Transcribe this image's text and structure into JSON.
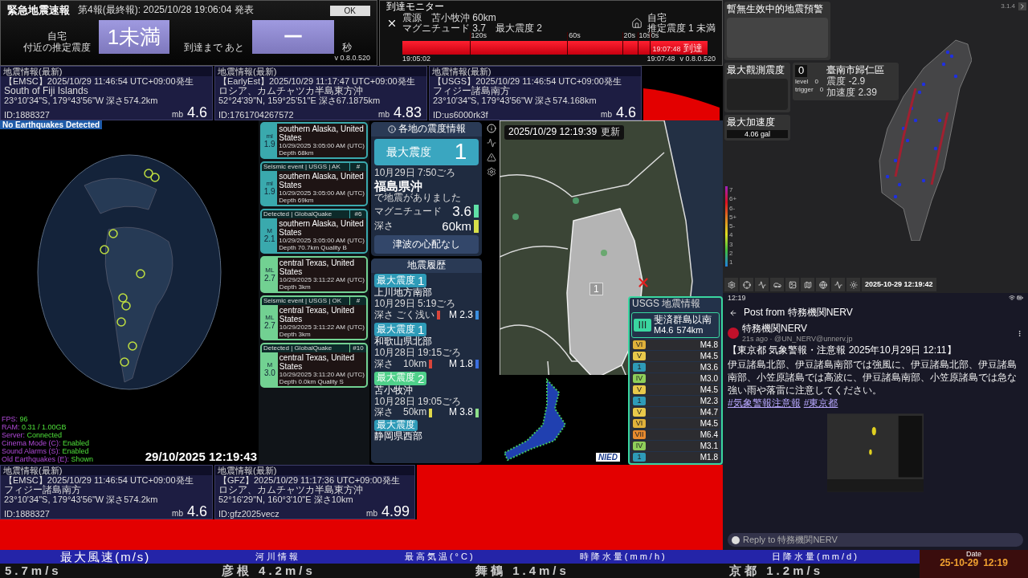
{
  "eew": {
    "title": "緊急地震速報",
    "report": "第4報(最終報): 2025/10/28 19:06:04 発表",
    "ok_button": "OK",
    "location_1": "自宅",
    "location_2": "付近の推定震度",
    "intensity": "1未満",
    "until_label": "到達まで あと",
    "seconds": "ー",
    "seconds_unit": "秒",
    "version": "v 0.8.0.520"
  },
  "arrival_monitor": {
    "title": "到達モニター",
    "epicenter": "震源　苫小牧沖 60km",
    "magnitude": "マグニチュード 3.7　最大震度 2",
    "home": "自宅",
    "home_intensity": "推定震度 1 未満",
    "ticks": [
      "120s",
      "60s",
      "20s",
      "10s",
      "0s"
    ],
    "arrival_time": "19:07:48",
    "arrival_label": "到達",
    "start_time": "19:05:02",
    "end_time": "19:07:48",
    "version": "v 0.8.0.520"
  },
  "quake_cards_top": [
    {
      "title": "地震情報(最新)",
      "header": "【EMSC】2025/10/29  11:46:54  UTC+09:00発生",
      "place": "South of Fiji Islands",
      "coords": "23°10'34\"S,  179°43'56\"W   深さ574.2km",
      "id": "ID:1888327",
      "mag_type": "mb",
      "mag": "4.6"
    },
    {
      "title": "地震情報(最新)",
      "header": "【EarlyEst】2025/10/29  11:17:47  UTC+09:00発生",
      "place": "ロシア、カムチャツカ半島東方沖",
      "coords": "52°24'39\"N,  159°25'51\"E   深さ67.1875km",
      "id": "ID:1761704267572",
      "mag_type": "mb",
      "mag": "4.83"
    },
    {
      "title": "地震情報(最新)",
      "header": "【USGS】2025/10/29  11:46:54  UTC+09:00発生",
      "place": "フィジー諸島南方",
      "coords": "23°10'34\"S,  179°43'56\"W   深さ574.168km",
      "id": "ID:us6000rk3f",
      "mag_type": "mb",
      "mag": "4.6"
    }
  ],
  "globe_panel": {
    "banner": "No Earthquakes Detected",
    "stats": [
      {
        "label": "FPS:",
        "value": "96"
      },
      {
        "label": "RAM:",
        "value": "0.31 / 1.00GB"
      },
      {
        "label": "Server:",
        "value": "Connected"
      },
      {
        "label": "Cinema Mode (C):",
        "value": "Enabled"
      },
      {
        "label": "Sound Alarms (S):",
        "value": "Enabled"
      },
      {
        "label": "Old Earthquakes (E):",
        "value": "Shown"
      }
    ],
    "datetime": "29/10/2025 12:19:43"
  },
  "event_list": [
    {
      "mag_type": "ml",
      "mag": "1.9",
      "place": "southern Alaska, United States",
      "time": "10/29/2025 3:05:00 AM (UTC)",
      "depth": "Depth 68km",
      "color": "#3aa9ad"
    },
    {
      "source": "Seismic event | USGS | AK",
      "number": "#",
      "mag_type": "ml",
      "mag": "1.9",
      "place": "southern Alaska, United States",
      "time": "10/29/2025 3:05:00 AM (UTC)",
      "depth": "Depth 69km",
      "color": "#3aa9ad"
    },
    {
      "source": "Detected | GlobalQuake",
      "number": "#6",
      "mag_type": "M",
      "mag": "2.1",
      "place": "southern Alaska, United States",
      "time": "10/29/2025 3:05:00 AM (UTC)",
      "depth": "Depth 70.7km",
      "quality": "Quality B",
      "color": "#3aa9ad"
    },
    {
      "mag_type": "ML",
      "mag": "2.7",
      "place": "central Texas, United States",
      "time": "10/29/2025 3:11:22 AM (UTC)",
      "depth": "Depth 3km",
      "color": "#72d192"
    },
    {
      "source": "Seismic event | USGS | OK",
      "number": "#",
      "mag_type": "ML",
      "mag": "2.7",
      "place": "central Texas, United States",
      "time": "10/29/2025 3:11:22 AM (UTC)",
      "depth": "Depth 3km",
      "color": "#72d192"
    },
    {
      "source": "Detected | GlobalQuake",
      "number": "#10",
      "mag_type": "M",
      "mag": "3.0",
      "place": "central Texas, United States",
      "time": "10/29/2025 3:11:20 AM (UTC)",
      "depth": "Depth 0.0km",
      "quality": "Quality S",
      "color": "#72d192"
    }
  ],
  "intensity_info": {
    "title": "各地の震度情報",
    "max_label": "最大震度",
    "max_value": "1",
    "time": "10月29日 7:50ごろ",
    "place": "福島県沖",
    "sentence": "で地震がありました",
    "magnitude": {
      "label": "マグニチュード",
      "value": "3.6",
      "color": "#5fe0a6"
    },
    "depth": {
      "label": "深さ",
      "value": "60km",
      "color": "#d8e04a"
    },
    "tsunami": "津波の心配なし"
  },
  "history": {
    "title": "地震履歴",
    "entries": [
      {
        "badge_label": "最大震度",
        "intensity": "1",
        "color": "#2e9bb8",
        "place": "上川地方南部",
        "time": "10月29日 5:19ごろ",
        "depth": {
          "text": "深さ ごく浅い",
          "color": "#d9453a"
        },
        "mag": {
          "text": "M 2.3",
          "color": "#3b8fe0"
        }
      },
      {
        "badge_label": "最大震度",
        "intensity": "1",
        "color": "#2e9bb8",
        "place": "和歌山県北部",
        "time": "10月28日 19:15ごろ",
        "depth": {
          "text": "深さ　10km",
          "color": "#d9453a"
        },
        "mag": {
          "text": "M 1.8",
          "color": "#3b6fe0"
        }
      },
      {
        "badge_label": "最大震度",
        "intensity": "2",
        "color": "#4fd08a",
        "place": "苫小牧沖",
        "time": "10月28日 19:05ごろ",
        "depth": {
          "text": "深さ　50km",
          "color": "#e0d84a"
        },
        "mag": {
          "text": "M 3.8",
          "color": "#8ee08a"
        }
      },
      {
        "badge_label": "最大震度",
        "color": "#2e9bb8",
        "place": "静岡県西部"
      }
    ]
  },
  "map": {
    "updated": "2025/10/29  12:19:39",
    "updated_label": "更新",
    "marker": "1",
    "inset_logo": "NIED"
  },
  "usgs": {
    "title": "USGS 地震情報",
    "intensity": "III",
    "place": "斐済群島以南",
    "mag": "M4.6",
    "depth": "574km",
    "entries": [
      {
        "intensity": "VI",
        "mag": "M4.8",
        "color": "#e0b13a"
      },
      {
        "intensity": "V",
        "mag": "M4.5",
        "color": "#e8c84a"
      },
      {
        "intensity": "1",
        "mag": "M3.6",
        "color": "#2e9bb8"
      },
      {
        "intensity": "IV",
        "mag": "M3.0",
        "color": "#8fcf5a"
      },
      {
        "intensity": "V",
        "mag": "M4.5",
        "color": "#e8c84a"
      },
      {
        "intensity": "1",
        "mag": "M2.3",
        "color": "#2e9bb8"
      },
      {
        "intensity": "V",
        "mag": "M4.7",
        "color": "#e8c84a"
      },
      {
        "intensity": "VI",
        "mag": "M4.5",
        "color": "#e0b13a"
      },
      {
        "intensity": "VII",
        "mag": "M6.4",
        "color": "#e88a2e"
      },
      {
        "intensity": "IV",
        "mag": "M3.1",
        "color": "#8fcf5a"
      },
      {
        "intensity": "1",
        "mag": "M1.8",
        "color": "#2e9bb8"
      }
    ]
  },
  "quake_cards_bottom": [
    {
      "title": "地震情報(最新)",
      "header": "【EMSC】2025/10/29  11:46:54  UTC+09:00発生",
      "place": "フィジー諸島南方",
      "coords": "23°10'34\"S,  179°43'56\"W   深さ574.2km",
      "id": "ID:1888327",
      "mag_type": "mb",
      "mag": "4.6"
    },
    {
      "title": "地震情報(最新)",
      "header": "【GFZ】2025/10/29  11:17:36  UTC+09:00発生",
      "place": "ロシア、カムチャツカ半島東方沖",
      "coords": "52°16'29\"N,  160°3'10\"E   深さ10km",
      "id": "ID:gfz2025vecz",
      "mag_type": "mb",
      "mag": "4.99"
    }
  ],
  "taiwan": {
    "version": "3.1.4",
    "no_warning": "暫無生效中的地震預警",
    "max_observed_label": "最大觀測震度",
    "station_intensity": "0",
    "station": "臺南市歸仁區",
    "station_shindo": "震度 -2.9",
    "station_accel": "加速度 2.39",
    "level": "level　0",
    "trigger": "trigger　0",
    "max_accel_label": "最大加速度",
    "max_accel": "4.06 gal",
    "legend": [
      "7",
      "6+",
      "6-",
      "5+",
      "5-",
      "4",
      "3",
      "2",
      "1"
    ],
    "datetime": "2025-10-29 12:19:42"
  },
  "post": {
    "clock": "12:19",
    "title": "Post from 特務機関NERV",
    "author": "特務機関NERV",
    "meta": "21s ago · @UN_NERV@unnerv.jp",
    "headline": "【東京都 気象警報・注意報 2025年10月29日 12:11】",
    "body": "伊豆諸島北部、伊豆諸島南部では強風に、伊豆諸島北部、伊豆諸島南部、小笠原諸島では高波に、伊豆諸島南部、小笠原諸島では急な強い雨や落雷に注意してください。",
    "hashtags": [
      "#気象警報注意報",
      "#東京都"
    ],
    "reply_placeholder": "Reply to 特務機関NERV"
  },
  "ticker": {
    "headings": [
      "最大風速(m/s)",
      "河川情報",
      "最高気温(°C)",
      "時降水量(mm/h)",
      "日降水量(mm/d)"
    ],
    "values": [
      "5.7m/s",
      "彦根 4.2m/s",
      "舞鶴 1.4m/s",
      "京都 1.2m/s"
    ],
    "date_label": "Date",
    "date": "25-10-29",
    "time": "12:19"
  }
}
